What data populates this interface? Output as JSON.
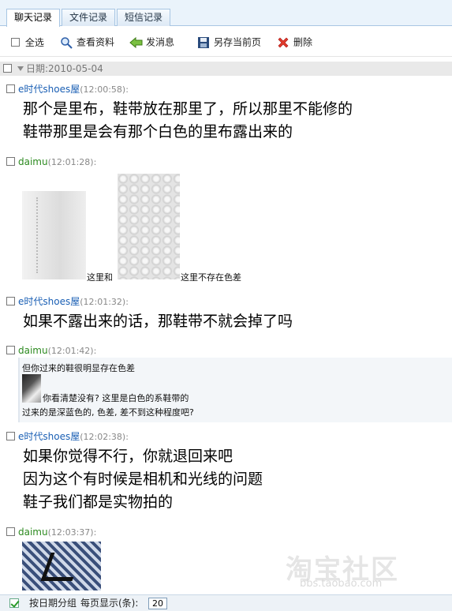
{
  "tabs": [
    {
      "label": "聊天记录"
    },
    {
      "label": "文件记录"
    },
    {
      "label": "短信记录"
    }
  ],
  "toolbar": {
    "select_all": "全选",
    "view_profile": "查看资料",
    "send_message": "发消息",
    "save_page": "另存当前页",
    "delete": "删除"
  },
  "date_header": "日期:2010-05-04",
  "messages": [
    {
      "sender": "e时代shoes屋",
      "time": "(12:00:58):",
      "lines": [
        "那个是里布，鞋带放在那里了，所以那里不能修的",
        "鞋带那里是会有那个白色的里布露出来的"
      ]
    },
    {
      "sender": "daimu",
      "time": "(12:01:28):",
      "caption1": "这里和",
      "caption2": "这里不存在色差"
    },
    {
      "sender": "e时代shoes屋",
      "time": "(12:01:32):",
      "lines": [
        "如果不露出来的话，那鞋带不就会掉了吗"
      ]
    },
    {
      "sender": "daimu",
      "time": "(12:01:42):",
      "quote_line1": "但你过来的鞋很明显存在色差",
      "quote_line2": "你看清楚没有? 这里是白色的系鞋带的",
      "quote_line3": "过来的是深蓝色的, 色差, 差不到这种程度吧?"
    },
    {
      "sender": "e时代shoes屋",
      "time": "(12:02:38):",
      "lines": [
        "如果你觉得不行，你就退回来吧",
        "因为这个有时候是相机和光线的问题",
        "鞋子我们都是实物拍的"
      ]
    },
    {
      "sender": "daimu",
      "time": "(12:03:37):"
    }
  ],
  "watermark": {
    "big": "淘宝社区",
    "small": "bbs.taobao.com"
  },
  "bottom": {
    "group_by_date": "按日期分组",
    "per_page_label": "每页显示(条):",
    "per_page_value": "20"
  },
  "colors": {
    "sender_shop": "#1a5fb4",
    "sender_user": "#2c8a1f",
    "tab_border": "#a8c6e3"
  }
}
